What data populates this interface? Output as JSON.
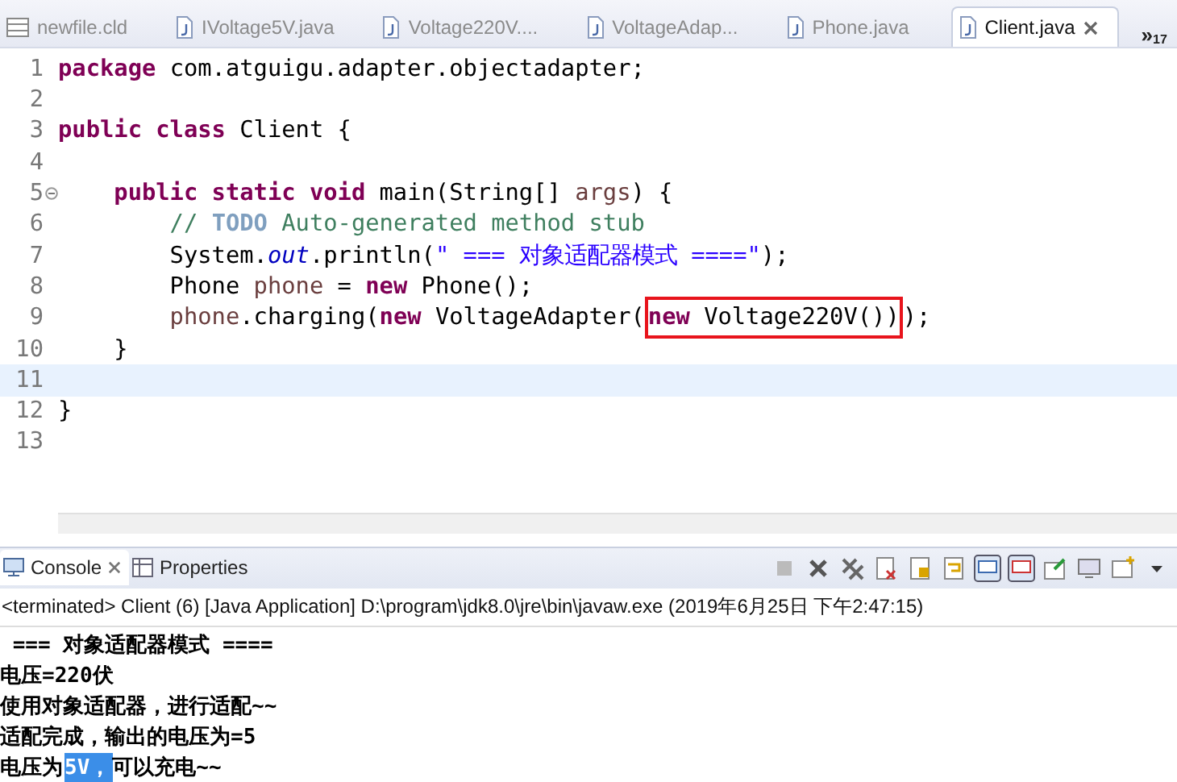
{
  "editor_tabs": [
    {
      "label": "newfile.cld",
      "kind": "diagram",
      "selected": false
    },
    {
      "label": "IVoltage5V.java",
      "kind": "java",
      "selected": false
    },
    {
      "label": "Voltage220V....",
      "kind": "java",
      "selected": false
    },
    {
      "label": "VoltageAdap...",
      "kind": "java",
      "selected": false
    },
    {
      "label": "Phone.java",
      "kind": "java",
      "selected": false
    },
    {
      "label": "Client.java",
      "kind": "java",
      "selected": true
    }
  ],
  "overflow": {
    "glyph": "»",
    "count": "17"
  },
  "editor": {
    "lines": [
      {
        "number": "1",
        "current": false,
        "segments": [
          {
            "kind": "keyword",
            "text": "package"
          },
          {
            "kind": "plain",
            "text": " com.atguigu.adapter.objectadapter;"
          }
        ]
      },
      {
        "number": "2",
        "current": false
      },
      {
        "number": "3",
        "current": false,
        "segments": [
          {
            "kind": "keyword",
            "text": "public class"
          },
          {
            "kind": "plain",
            "text": " Client {"
          }
        ]
      },
      {
        "number": "4",
        "current": false
      },
      {
        "number": "5",
        "current": false,
        "fold": true,
        "segments": [
          {
            "kind": "keyword",
            "text": "    public static void"
          },
          {
            "kind": "plain",
            "text": " main(String[] "
          },
          {
            "kind": "local",
            "text": "args"
          },
          {
            "kind": "plain",
            "text": ") {"
          }
        ]
      },
      {
        "number": "6",
        "current": false,
        "segments": [
          {
            "kind": "comment",
            "text": "        // "
          },
          {
            "kind": "todo",
            "text": "TODO"
          },
          {
            "kind": "comment",
            "text": " Auto-generated method stub"
          }
        ]
      },
      {
        "number": "7",
        "current": false,
        "segments": [
          {
            "kind": "plain",
            "text": "        System."
          },
          {
            "kind": "static",
            "text": "out"
          },
          {
            "kind": "plain",
            "text": ".println("
          },
          {
            "kind": "string",
            "text": "\" === 对象适配器模式 ====\""
          },
          {
            "kind": "plain",
            "text": ");"
          }
        ]
      },
      {
        "number": "8",
        "current": false,
        "segments": [
          {
            "kind": "plain",
            "text": "        Phone "
          },
          {
            "kind": "local",
            "text": "phone"
          },
          {
            "kind": "plain",
            "text": " = "
          },
          {
            "kind": "keyword",
            "text": "new"
          },
          {
            "kind": "plain",
            "text": " Phone();"
          }
        ]
      },
      {
        "number": "9",
        "current": false,
        "segments": [
          {
            "kind": "local",
            "text": "        phone"
          },
          {
            "kind": "plain",
            "text": ".charging("
          },
          {
            "kind": "keyword",
            "text": "new"
          },
          {
            "kind": "plain",
            "text": " VoltageAdapter("
          },
          {
            "kind": "boxed",
            "children": [
              {
                "kind": "keyword",
                "text": "new"
              },
              {
                "kind": "plain",
                "text": " Voltage220V())"
              }
            ]
          },
          {
            "kind": "plain",
            "text": ");"
          }
        ]
      },
      {
        "number": "10",
        "current": false,
        "segments": [
          {
            "kind": "plain",
            "text": "    }"
          }
        ]
      },
      {
        "number": "11",
        "current": true
      },
      {
        "number": "12",
        "current": false,
        "segments": [
          {
            "kind": "plain",
            "text": "}"
          }
        ]
      },
      {
        "number": "13",
        "current": false
      }
    ]
  },
  "console_tabs": [
    {
      "label": "Console",
      "kind": "console",
      "selected": true
    },
    {
      "label": "Properties",
      "kind": "properties",
      "selected": false
    }
  ],
  "console": {
    "status": "<terminated> Client (6) [Java Application] D:\\program\\jdk8.0\\jre\\bin\\javaw.exe (2019年6月25日 下午2:47:15)",
    "output": [
      [
        {
          "text": " === 对象适配器模式 ====",
          "selected": false
        }
      ],
      [
        {
          "text": "电压=220伏",
          "selected": false
        }
      ],
      [
        {
          "text": "使用对象适配器，进行适配~~",
          "selected": false
        }
      ],
      [
        {
          "text": "适配完成，输出的电压为=5",
          "selected": false
        }
      ],
      [
        {
          "text": "电压为",
          "selected": false
        },
        {
          "text": "5V，",
          "selected": true
        },
        {
          "text": "可以充电~~",
          "selected": false
        }
      ]
    ]
  }
}
